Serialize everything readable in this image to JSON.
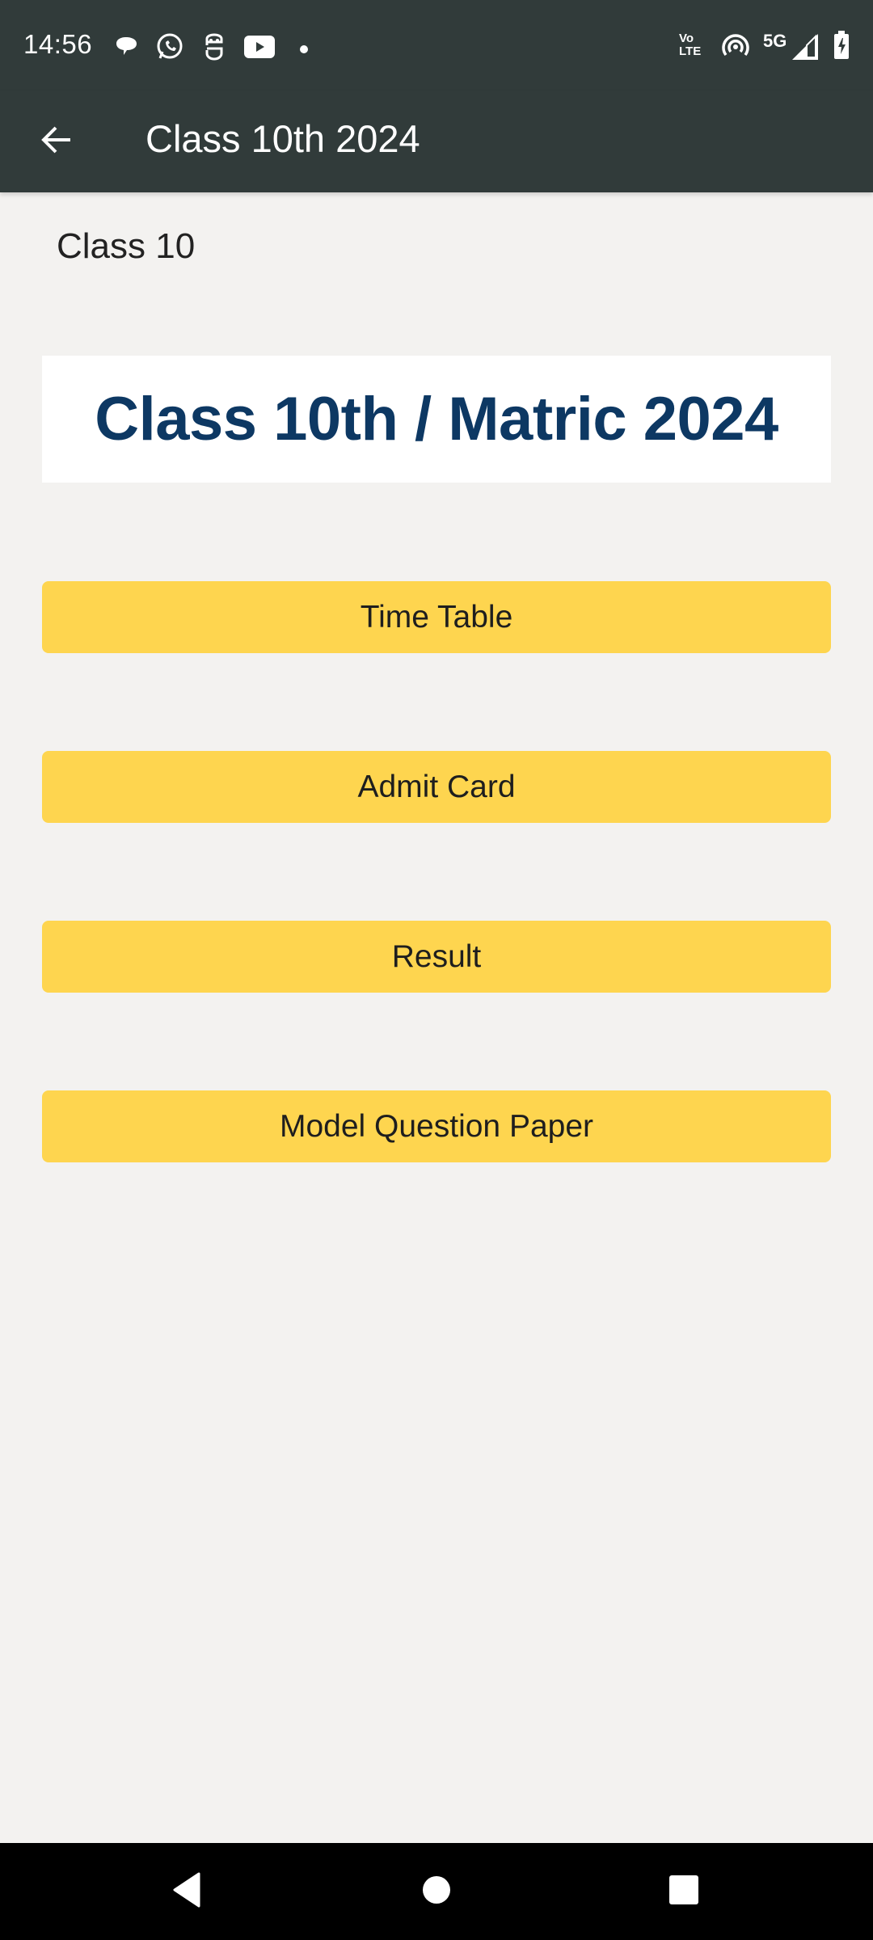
{
  "status_bar": {
    "time": "14:56",
    "notification_icons": [
      "messages-icon",
      "whatsapp-icon",
      "app-notification-icon",
      "youtube-icon",
      "more-dot-icon"
    ],
    "system_icons": [
      "volte-icon",
      "hotspot-icon",
      "5g-icon",
      "signal-icon",
      "battery-charging-icon"
    ],
    "network_label": "5G",
    "volte_top": "Vo",
    "volte_bottom": "LTE"
  },
  "app_bar": {
    "title": "Class 10th 2024",
    "back_icon": "arrow-left-icon"
  },
  "content": {
    "section_label": "Class 10",
    "banner_text": "Class 10th / Matric 2024",
    "buttons": [
      {
        "label": "Time Table"
      },
      {
        "label": "Admit Card"
      },
      {
        "label": "Result"
      },
      {
        "label": "Model Question Paper"
      }
    ]
  },
  "nav_bar": {
    "buttons": [
      "back-icon",
      "home-icon",
      "recents-icon"
    ]
  },
  "colors": {
    "app_bar": "#313b3a",
    "background": "#f3f2f0",
    "button": "#fed54f",
    "banner_text": "#0d3863"
  }
}
